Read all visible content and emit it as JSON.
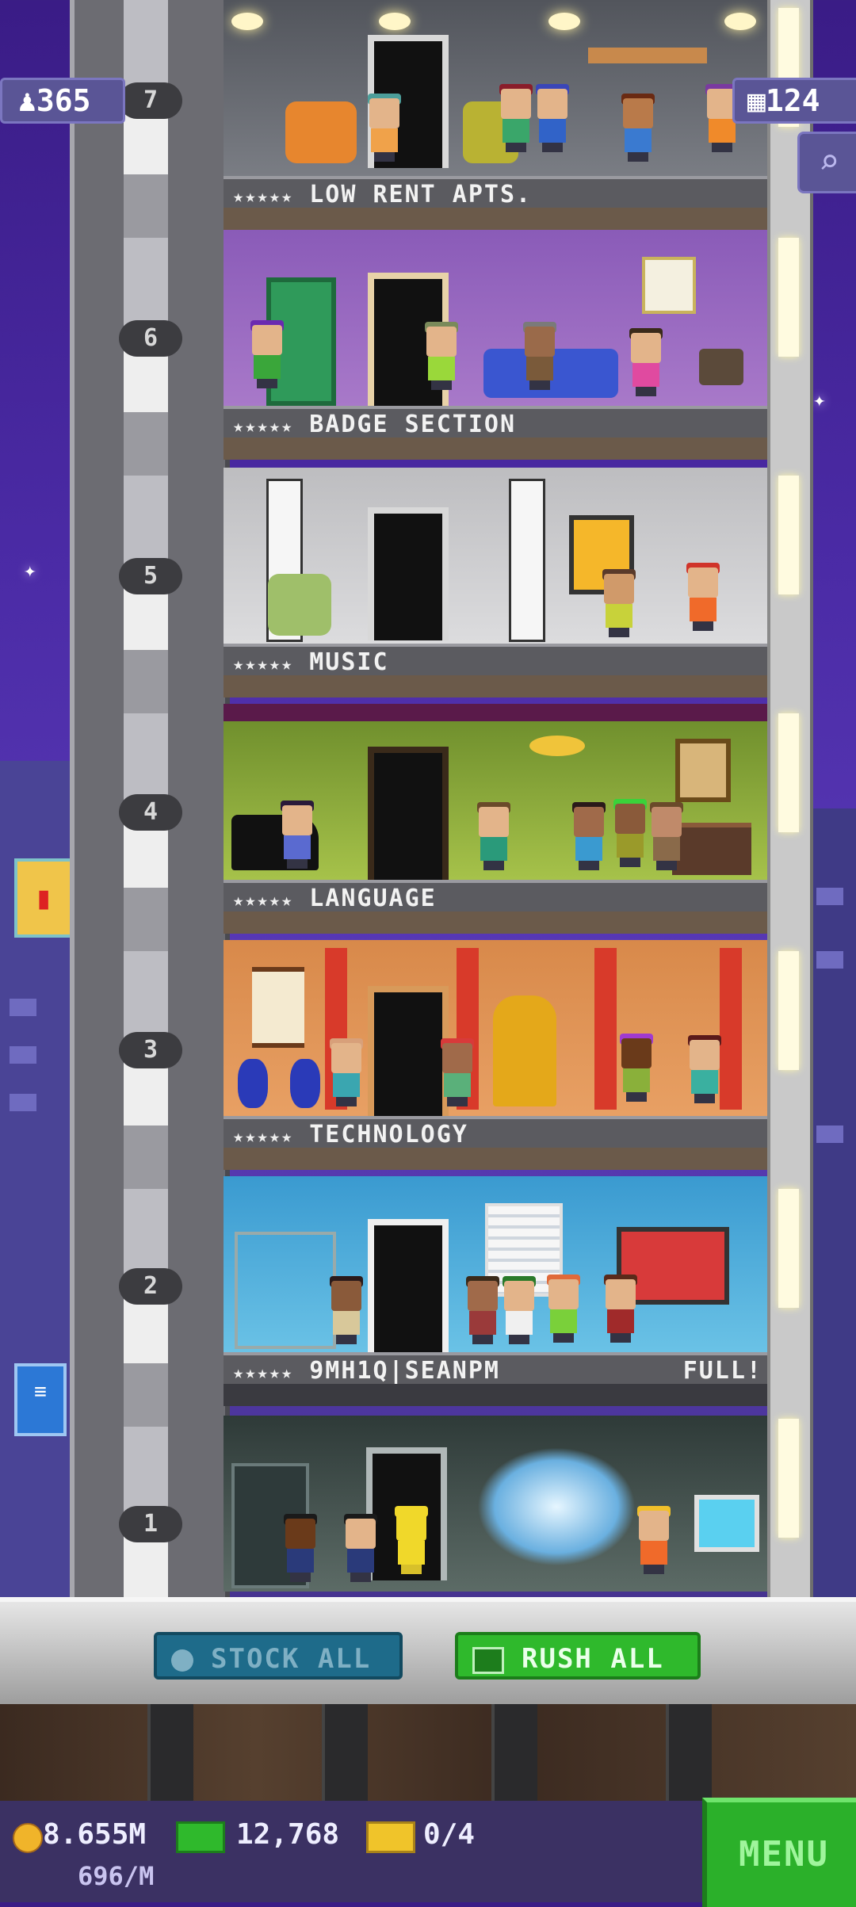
{
  "top": {
    "population": "365",
    "bux_stat": "124",
    "population_icon": "person-icon",
    "bux_icon": "building-icon",
    "search_icon": "magnifier-icon"
  },
  "floors": [
    {
      "number": "7",
      "name": "LOW RENT APTS.",
      "stars": "★★★★★",
      "status": ""
    },
    {
      "number": "6",
      "name": "BADGE SECTION",
      "stars": "★★★★★",
      "status": ""
    },
    {
      "number": "5",
      "name": "MUSIC",
      "stars": "★★★★★",
      "status": ""
    },
    {
      "number": "4",
      "name": "LANGUAGE",
      "stars": "★★★★★",
      "status": ""
    },
    {
      "number": "3",
      "name": "TECHNOLOGY",
      "stars": "★★★★★",
      "status": ""
    },
    {
      "number": "2",
      "name": "9MH1Q|SEANPM",
      "stars": "★★★★★",
      "status": "FULL!"
    },
    {
      "number": "1",
      "name": "",
      "stars": "",
      "status": ""
    }
  ],
  "actions": {
    "stock_all": "STOCK ALL",
    "rush_all": "RUSH ALL"
  },
  "hud": {
    "coins": "8.655M",
    "coins_rate": "696/M",
    "bux": "12,768",
    "tickets": "0/4",
    "menu": "MENU"
  },
  "colors": {
    "sky": "#4b2ba6",
    "rush_green": "#2fb92c",
    "stock_blue": "#1e6b8a",
    "menu_green": "#2bb02a"
  }
}
